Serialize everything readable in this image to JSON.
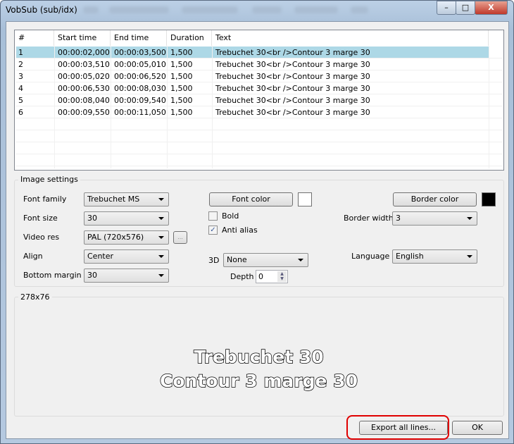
{
  "window": {
    "title": "VobSub (sub/idx)",
    "minimize": "–",
    "maximize": "□",
    "close": "X"
  },
  "list": {
    "columns": [
      "#",
      "Start time",
      "End time",
      "Duration",
      "Text"
    ],
    "rows": [
      [
        "1",
        "00:00:02,000",
        "00:00:03,500",
        "1,500",
        "Trebuchet 30<br />Contour 3 marge 30"
      ],
      [
        "2",
        "00:00:03,510",
        "00:00:05,010",
        "1,500",
        "Trebuchet 30<br />Contour 3 marge 30"
      ],
      [
        "3",
        "00:00:05,020",
        "00:00:06,520",
        "1,500",
        "Trebuchet 30<br />Contour 3 marge 30"
      ],
      [
        "4",
        "00:00:06,530",
        "00:00:08,030",
        "1,500",
        "Trebuchet 30<br />Contour 3 marge 30"
      ],
      [
        "5",
        "00:00:08,040",
        "00:00:09,540",
        "1,500",
        "Trebuchet 30<br />Contour 3 marge 30"
      ],
      [
        "6",
        "00:00:09,550",
        "00:00:11,050",
        "1,500",
        "Trebuchet 30<br />Contour 3 marge 30"
      ]
    ]
  },
  "settings": {
    "group_label": "Image settings",
    "font_family_label": "Font family",
    "font_family": "Trebuchet MS",
    "font_size_label": "Font size",
    "font_size": "30",
    "video_res_label": "Video res",
    "video_res": "PAL (720x576)",
    "video_res_more": "...",
    "align_label": "Align",
    "align": "Center",
    "bottom_margin_label": "Bottom margin",
    "bottom_margin": "30",
    "font_color_button": "Font color",
    "font_color": "#ffffff",
    "bold_label": "Bold",
    "bold_checked": false,
    "anti_alias_label": "Anti alias",
    "anti_alias_checked": true,
    "three_d_label": "3D",
    "three_d": "None",
    "depth_label": "Depth",
    "depth": "0",
    "border_color_button": "Border color",
    "border_color": "#000000",
    "border_width_label": "Border width",
    "border_width": "3",
    "language_label": "Language",
    "language": "English"
  },
  "preview": {
    "size_label": "278x76",
    "line1": "Trebuchet 30",
    "line2": "Contour 3 marge 30"
  },
  "buttons": {
    "export": "Export all lines...",
    "ok": "OK"
  }
}
